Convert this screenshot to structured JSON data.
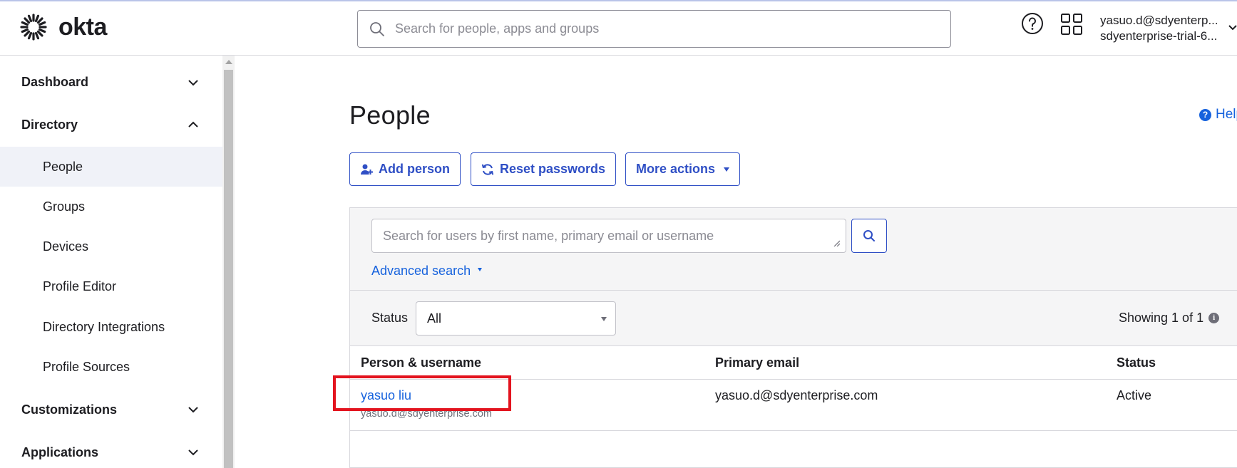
{
  "header": {
    "logo_text": "okta",
    "search_placeholder": "Search for people, apps and groups",
    "icons": {
      "logo": "okta-sunburst-icon",
      "search": "search-icon",
      "help": "help-circle-icon",
      "apps": "app-grid-icon",
      "account": "chevron-down-icon"
    },
    "user_email": "yasuo.d@sdyenterp...",
    "user_org": "sdyenterprise-trial-6..."
  },
  "sidebar": {
    "sections": [
      {
        "label": "Dashboard",
        "expanded": false
      },
      {
        "label": "Directory",
        "expanded": true
      },
      {
        "label": "Customizations",
        "expanded": false
      },
      {
        "label": "Applications",
        "expanded": false
      }
    ],
    "directory_items": [
      {
        "label": "People",
        "active": true
      },
      {
        "label": "Groups"
      },
      {
        "label": "Devices"
      },
      {
        "label": "Profile Editor"
      },
      {
        "label": "Directory Integrations"
      },
      {
        "label": "Profile Sources"
      }
    ]
  },
  "main": {
    "title": "People",
    "help_label": "Help",
    "buttons": {
      "add_person": "Add person",
      "reset_passwords": "Reset passwords",
      "more_actions": "More actions"
    },
    "user_search_placeholder": "Search for users by first name, primary email or username",
    "advanced_search": "Advanced search",
    "filter": {
      "status_label": "Status",
      "status_value": "All"
    },
    "showing": "Showing 1 of 1",
    "table": {
      "columns": [
        "Person & username",
        "Primary email",
        "Status"
      ],
      "rows": [
        {
          "name": "yasuo liu",
          "username": "yasuo.d@sdyenterprise.com",
          "email": "yasuo.d@sdyenterprise.com",
          "status": "Active"
        }
      ]
    }
  },
  "colors": {
    "accent": "#2f4fc5",
    "link": "#1662dd",
    "highlight": "#e3141f",
    "active_nav_bg": "#f0f2f8",
    "panel_bg": "#f5f5f6"
  }
}
